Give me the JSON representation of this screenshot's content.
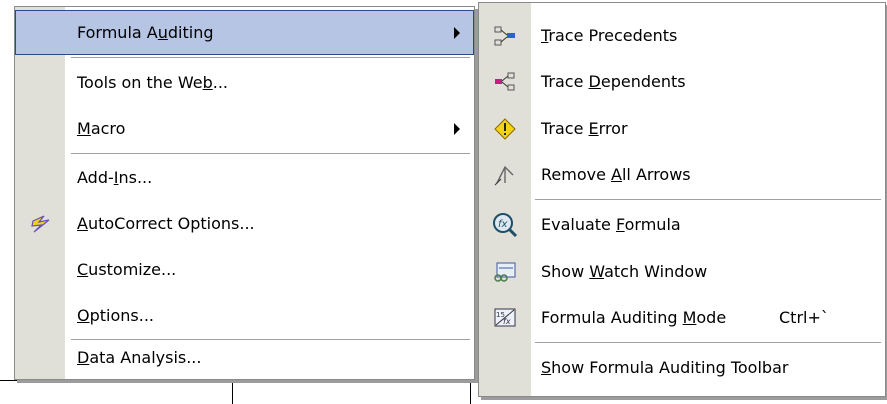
{
  "tools_menu": {
    "items": [
      {
        "label_parts": [
          "Formula A",
          "u",
          "diting"
        ],
        "has_submenu": true,
        "selected": true
      },
      {
        "label_parts": [
          "Tools on the We",
          "b",
          "..."
        ],
        "has_submenu": false
      },
      {
        "label_parts": [
          "",
          "M",
          "acro"
        ],
        "has_submenu": true
      },
      {
        "label_parts": [
          "Add-",
          "I",
          "ns..."
        ],
        "has_submenu": false
      },
      {
        "label_parts": [
          "",
          "A",
          "utoCorrect Options..."
        ],
        "has_submenu": false,
        "icon": "autocorrect-lightning-icon"
      },
      {
        "label_parts": [
          "",
          "C",
          "ustomize..."
        ],
        "has_submenu": false
      },
      {
        "label_parts": [
          "",
          "O",
          "ptions..."
        ],
        "has_submenu": false
      },
      {
        "label_parts": [
          "",
          "D",
          "ata Analysis..."
        ],
        "has_submenu": false
      }
    ]
  },
  "auditing_submenu": {
    "items": [
      {
        "label_parts": [
          "",
          "T",
          "race Precedents"
        ],
        "icon": "trace-precedents-icon"
      },
      {
        "label_parts": [
          "Trace ",
          "D",
          "ependents"
        ],
        "icon": "trace-dependents-icon"
      },
      {
        "label_parts": [
          "Trace ",
          "E",
          "rror"
        ],
        "icon": "trace-error-icon"
      },
      {
        "label_parts": [
          "Remove ",
          "A",
          "ll Arrows"
        ],
        "icon": "remove-arrows-icon"
      },
      {
        "label_parts": [
          "Evaluate ",
          "F",
          "ormula"
        ],
        "icon": "evaluate-formula-icon"
      },
      {
        "label_parts": [
          "Show ",
          "W",
          "atch Window"
        ],
        "icon": "watch-window-icon"
      },
      {
        "label_parts": [
          "Formula Auditing ",
          "M",
          "ode"
        ],
        "icon": "auditing-mode-icon",
        "shortcut": "Ctrl+`"
      },
      {
        "label_parts": [
          "",
          "S",
          "how Formula Auditing Toolbar"
        ]
      }
    ]
  },
  "colors": {
    "highlight": "#b6c5e4",
    "highlight_border": "#2a4a8a",
    "gutter": "#e0e0d8"
  }
}
